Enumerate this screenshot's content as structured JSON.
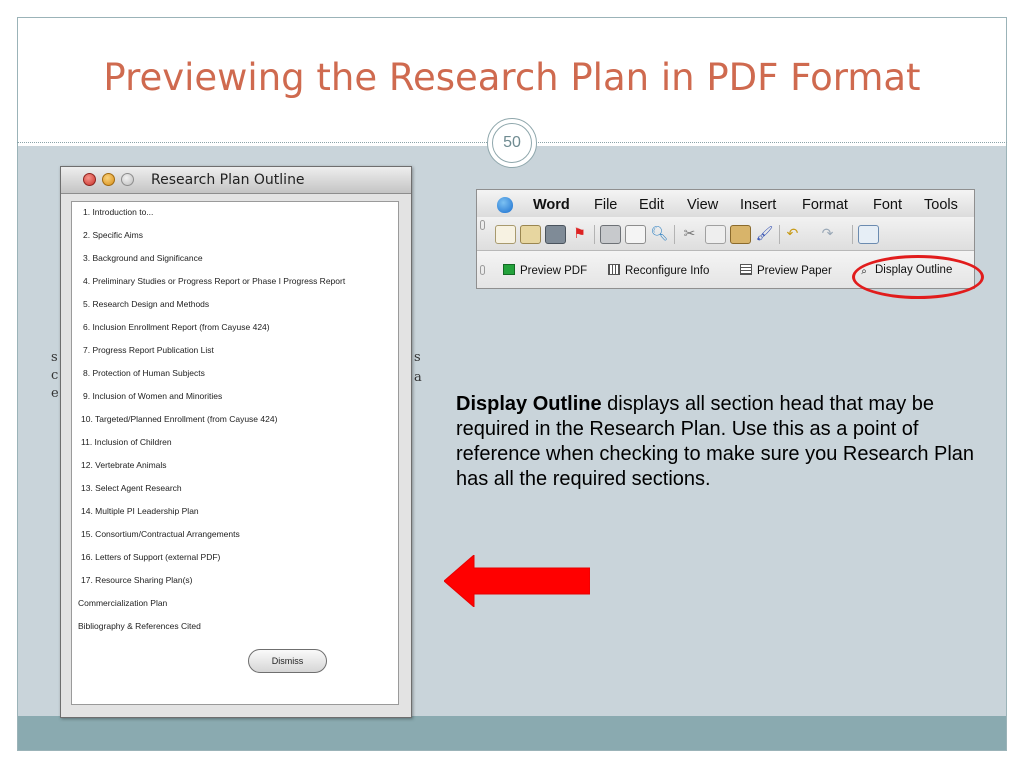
{
  "slide": {
    "title": "Previewing the Research Plan in PDF Format",
    "page_number": "50"
  },
  "outline_window": {
    "title": "Research Plan Outline",
    "items": [
      "1. Introduction to...",
      "2. Specific Aims",
      "3. Background and Significance",
      "4. Preliminary Studies or Progress Report or Phase I Progress Report",
      "5. Research Design and Methods",
      "6. Inclusion Enrollment Report (from Cayuse 424)",
      "7. Progress Report Publication List",
      "8. Protection of Human Subjects",
      "9. Inclusion of Women and Minorities",
      "10. Targeted/Planned Enrollment (from Cayuse 424)",
      "11. Inclusion of Children",
      "12. Vertebrate Animals",
      "13. Select Agent Research",
      "14. Multiple PI Leadership Plan",
      "15. Consortium/Contractual Arrangements",
      "16. Letters of Support (external PDF)",
      "17. Resource Sharing Plan(s)",
      "Commercialization Plan",
      "Bibliography & References Cited"
    ],
    "dismiss_label": "Dismiss",
    "stray_left": [
      "s",
      "c",
      "e"
    ],
    "stray_right": [
      "s",
      "a"
    ]
  },
  "word_toolbar": {
    "menu": [
      "Word",
      "File",
      "Edit",
      "View",
      "Insert",
      "Format",
      "Font",
      "Tools"
    ],
    "icons": [
      "new-document-icon",
      "open-icon",
      "save-icon",
      "flag-icon",
      "print-icon",
      "print-preview-icon",
      "search-icon",
      "cut-icon",
      "copy-icon",
      "paste-icon",
      "format-painter-icon",
      "undo-icon",
      "redo-icon",
      "edit-icon"
    ],
    "buttons": {
      "preview_pdf": "Preview PDF",
      "reconfigure_info": "Reconfigure Info",
      "preview_paper": "Preview Paper",
      "display_outline": "Display Outline"
    }
  },
  "callout": {
    "bold": "Display Outline",
    "text": " displays all section head that may be required in the Research Plan.  Use this as a point of reference when checking to make sure you Research Plan has all the required sections."
  },
  "colors": {
    "title": "#cf6a4f",
    "body_background": "#c9d4da",
    "bottom_band": "#8aaab0",
    "highlight": "#e11c1c",
    "arrow": "#ff0000"
  }
}
